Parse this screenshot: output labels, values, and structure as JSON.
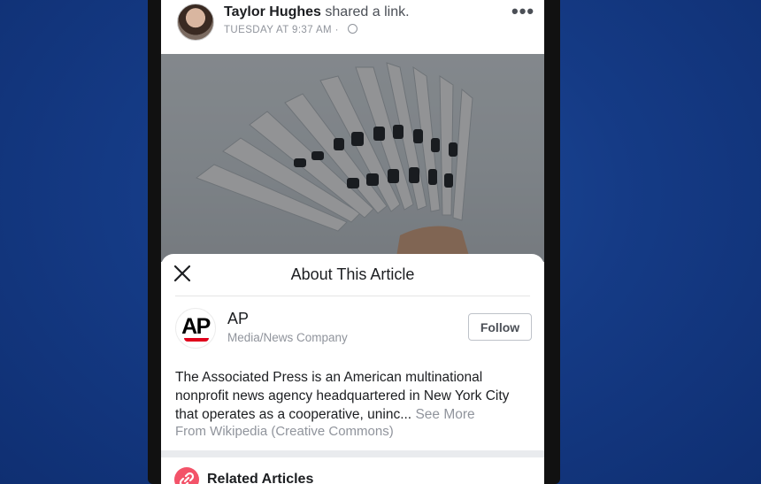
{
  "post": {
    "author": "Taylor Hughes",
    "action": "shared a link.",
    "timestamp": "TUESDAY AT 9:37 AM",
    "more_icon": "more-dots-icon"
  },
  "sheet": {
    "title": "About This Article",
    "publisher": {
      "logo_text": "AP",
      "name": "AP",
      "category": "Media/News Company",
      "follow_label": "Follow"
    },
    "description": "The Associated Press is an American multinational nonprofit news agency headquartered in New York City that operates as a cooperative, uninc...",
    "see_more": "See More",
    "source": "From Wikipedia (Creative Commons)",
    "related_title": "Related Articles"
  },
  "colors": {
    "background": "#153b86",
    "ap_red": "#e0001b",
    "related_icon": "#f35369"
  }
}
